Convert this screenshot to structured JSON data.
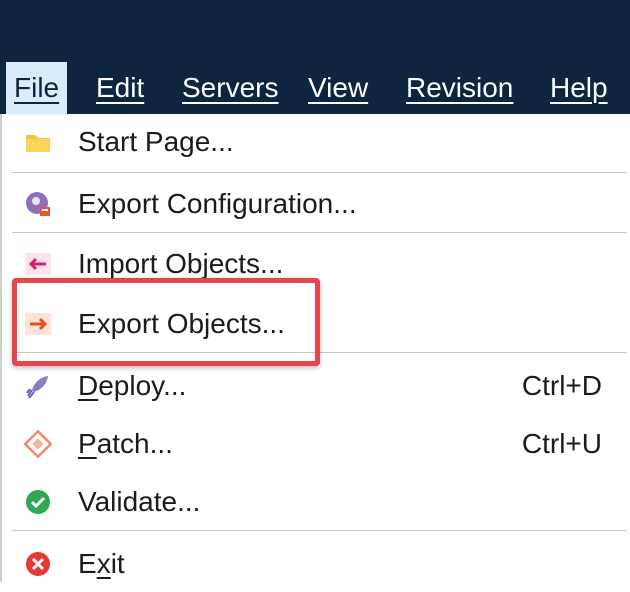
{
  "menubar": {
    "items": [
      {
        "label": "File",
        "active": true
      },
      {
        "label": "Edit"
      },
      {
        "label": "Servers"
      },
      {
        "label": "View"
      },
      {
        "label": "Revision"
      },
      {
        "label": "Help"
      }
    ]
  },
  "file_menu": {
    "items": [
      {
        "label": "Start Page...",
        "icon": "folder-icon"
      },
      {
        "label": "Export Configuration...",
        "icon": "export-configuration-icon"
      },
      {
        "label": "Import Objects...",
        "icon": "import-arrow-icon"
      },
      {
        "label": "Export Objects...",
        "icon": "export-arrow-icon",
        "highlighted": true
      },
      {
        "label": "Deploy...",
        "shortcut": "Ctrl+D",
        "icon": "rocket-icon"
      },
      {
        "label": "Patch...",
        "shortcut": "Ctrl+U",
        "icon": "patch-icon"
      },
      {
        "label": "Validate...",
        "icon": "check-circle-icon"
      },
      {
        "label": "Exit",
        "icon": "close-circle-icon"
      }
    ]
  },
  "colors": {
    "menubar_bg": "#0e2540",
    "active_menu_bg": "#d9ecfb",
    "highlight_border": "#e8444b"
  }
}
